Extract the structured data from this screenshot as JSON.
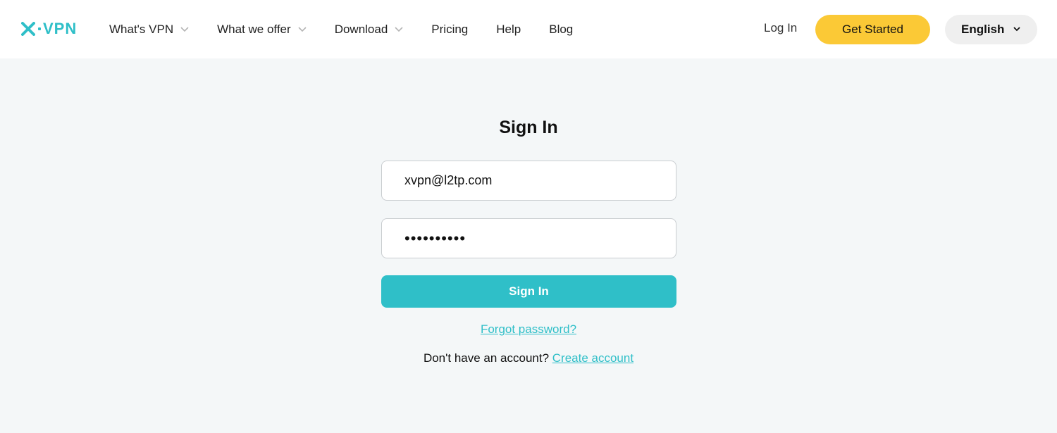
{
  "header": {
    "logo_text": "VPN",
    "logo_color": "#2fbfc8",
    "nav": [
      {
        "label": "What's VPN",
        "has_dropdown": true
      },
      {
        "label": "What we offer",
        "has_dropdown": true
      },
      {
        "label": "Download",
        "has_dropdown": true
      },
      {
        "label": "Pricing",
        "has_dropdown": false
      },
      {
        "label": "Help",
        "has_dropdown": false
      },
      {
        "label": "Blog",
        "has_dropdown": false
      }
    ],
    "login_label": "Log In",
    "cta_label": "Get Started",
    "cta_color": "#fbc936",
    "language": "English"
  },
  "signin": {
    "title": "Sign In",
    "email_value": "xvpn@l2tp.com",
    "password_value": "••••••••••",
    "button_label": "Sign In",
    "button_color": "#2fbfc8",
    "forgot_label": "Forgot password?",
    "no_account_text": "Don't have an account? ",
    "create_account_label": "Create account"
  }
}
